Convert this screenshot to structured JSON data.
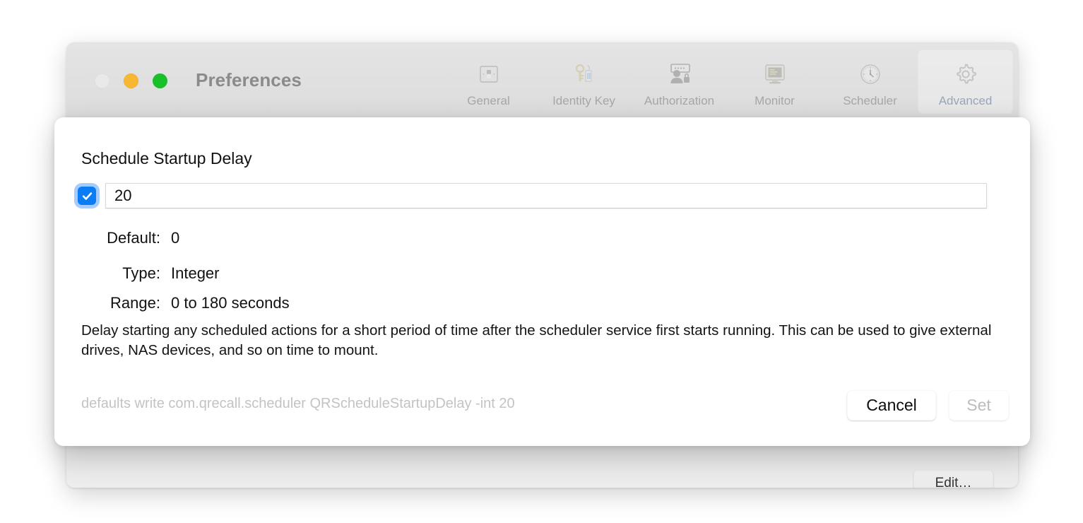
{
  "window": {
    "title": "Preferences",
    "traffic_lights": [
      {
        "name": "close",
        "color": "#e9e9e9"
      },
      {
        "name": "minimize",
        "color": "#f7b731"
      },
      {
        "name": "maximize",
        "color": "#19c02a"
      }
    ],
    "toolbar": {
      "selected": "Advanced",
      "accent_selected_text": "#9aa4bd",
      "items": [
        {
          "label": "General",
          "icon": "general-switch-icon"
        },
        {
          "label": "Identity Key",
          "icon": "key-tag-icon"
        },
        {
          "label": "Authorization",
          "icon": "user-lock-icon"
        },
        {
          "label": "Monitor",
          "icon": "monitor-icon"
        },
        {
          "label": "Scheduler",
          "icon": "clock-icon"
        },
        {
          "label": "Advanced",
          "icon": "gear-icon"
        }
      ]
    },
    "background_button": {
      "label": "Edit…"
    }
  },
  "sheet": {
    "title": "Schedule Startup Delay",
    "checkbox": {
      "checked": true,
      "accent": "#0a7cf4",
      "focus_ring": "#3c8cf8"
    },
    "value_field": {
      "value": "20",
      "placeholder": ""
    },
    "meta": [
      {
        "label": "Default:",
        "value": "0"
      },
      {
        "label": "Type:",
        "value": "Integer"
      },
      {
        "label": "Range:",
        "value": "0 to 180 seconds"
      }
    ],
    "description": "Delay starting any scheduled actions for a short period of time after the scheduler service first starts running. This can be used to give external drives, NAS devices, and so on time to mount.",
    "command": "defaults write com.qrecall.scheduler QRScheduleStartupDelay -int 20",
    "buttons": {
      "cancel": {
        "label": "Cancel",
        "enabled": true
      },
      "set": {
        "label": "Set",
        "enabled": false
      }
    }
  }
}
